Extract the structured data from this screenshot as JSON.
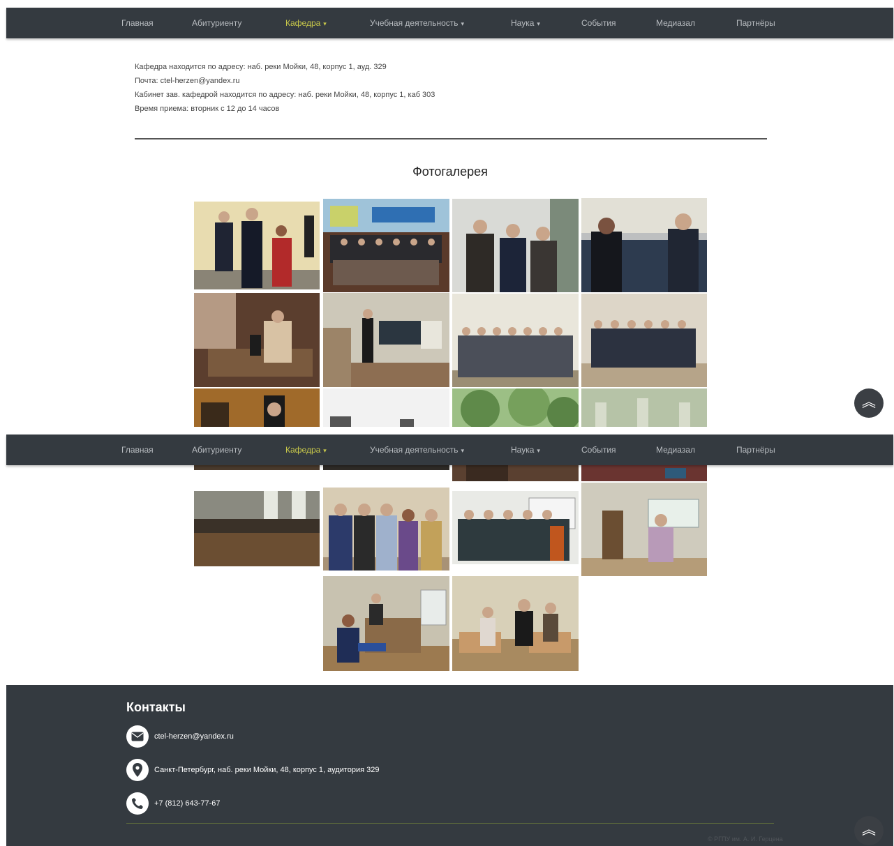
{
  "nav": {
    "items": [
      {
        "label": "Главная",
        "dropdown": false,
        "active": false
      },
      {
        "label": "Абитуриенту",
        "dropdown": false,
        "active": false
      },
      {
        "label": "Кафедра",
        "dropdown": true,
        "active": true
      },
      {
        "label": "Учебная деятельность",
        "dropdown": true,
        "active": false
      },
      {
        "label": "Наука",
        "dropdown": true,
        "active": false
      },
      {
        "label": "События",
        "dropdown": false,
        "active": false
      },
      {
        "label": "Медиазал",
        "dropdown": false,
        "active": false
      },
      {
        "label": "Партнёры",
        "dropdown": false,
        "active": false
      }
    ],
    "caret": "▾"
  },
  "info": {
    "address": "Кафедра находится по адресу: наб. реки Мойки, 48, корпус 1, ауд. 329",
    "email": "Почта: ctel-herzen@yandex.ru",
    "office": "Кабинет зав. кафедрой находится по адресу: наб. реки Мойки, 48, корпус 1, каб 303",
    "hours": "Время приема: вторник с 12 до 14 часов"
  },
  "gallery": {
    "title": "Фотогалерея",
    "photos": [
      "officials-handshake-photo",
      "apec-e-learning-group-photo",
      "three-young-men-photo",
      "street-conversation-photo",
      "classroom-desks-photo",
      "lecture-presentation-photo",
      "large-group-photo",
      "group-standing-hall-photo",
      "graduate-cap-photo",
      "outdoor-event-photo",
      "trees-photo",
      "hall-arches-photo",
      "auditorium-photo",
      "students-group-photo",
      "group-whiteboard-photo",
      "speaker-podium-photo",
      "presentation-room-photo",
      "classroom-group-work-photo"
    ]
  },
  "footer": {
    "title": "Контакты",
    "email": "ctel-herzen@yandex.ru",
    "address": "Санкт-Петербург, наб. реки Мойки, 48, корпус 1, аудитория 329",
    "phone": "+7 (812) 643-77-67",
    "copyright": "© РГПУ им. А. И. Герцена"
  },
  "scroll_top": {
    "icon": "double-chevron-up-icon",
    "symbol": "︽"
  },
  "colors": {
    "navbar": "#343a40",
    "nav_text": "#b8bcc0",
    "nav_active": "#c8c84a",
    "footer": "#343a40",
    "footer_line": "#5d6a3c"
  }
}
